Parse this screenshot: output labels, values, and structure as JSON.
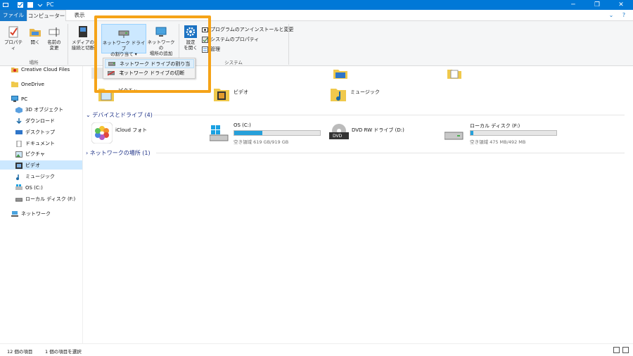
{
  "window": {
    "title": "PC",
    "minimize": "─",
    "maximize": "❐",
    "close": "✕"
  },
  "tabs": {
    "file": "ファイル",
    "computer": "コンピューター",
    "view": "表示"
  },
  "ribbon": {
    "properties": "プロパティ",
    "open": "開く",
    "rename_line1": "名前の",
    "rename_line2": "変更",
    "group_location": "場所",
    "media_line1": "メディアの",
    "media_line2": "接続と切断",
    "map_drive_line1": "ネットワーク ドライブ",
    "map_drive_line2": "の割り当て ▾",
    "add_location_line1": "ネットワークの",
    "add_location_line2": "場所の追加",
    "settings_line1": "設定",
    "settings_line2": "を開く",
    "uninstall": "プログラムのアンインストールと変更",
    "sys_props": "システムのプロパティ",
    "manage": "管理",
    "group_system": "システム"
  },
  "dropdown": {
    "map": "ネットワーク ドライブの割り当て",
    "disconnect": "ネットワーク ドライブの切断"
  },
  "nav": {
    "creative_cloud": "Creative Cloud Files",
    "onedrive": "OneDrive",
    "pc": "PC",
    "objects3d": "3D オブジェクト",
    "downloads": "ダウンロード",
    "desktop": "デスクトップ",
    "documents": "ドキュメント",
    "pictures": "ピクチャ",
    "videos": "ビデオ",
    "music": "ミュージック",
    "os_c": "OS (C:)",
    "local_f": "ローカル ディスク (F:)",
    "network": "ネットワーク"
  },
  "folders": {
    "pictures": "ピクチャ",
    "videos": "ビデオ",
    "music": "ミュージック"
  },
  "sections": {
    "devices": "デバイスとドライブ (4)",
    "netlocs": "ネットワークの場所 (1)"
  },
  "drives": {
    "icloud": "iCloud フォト",
    "os_name": "OS (C:)",
    "os_free": "空き領域 619 GB/919 GB",
    "os_used_fraction": 0.33,
    "dvd_name": "DVD RW ドライブ (D:)",
    "dvd_label": "DVD",
    "local_name": "ローカル ディスク (F:)",
    "local_free": "空き領域 475 MB/492 MB",
    "local_used_fraction": 0.035
  },
  "status": {
    "count": "12 個の項目",
    "selected": "1 個の項目を選択"
  },
  "colors": {
    "accent": "#0078d7",
    "highlight": "#f5a318",
    "bar_fill": "#26a0da"
  }
}
